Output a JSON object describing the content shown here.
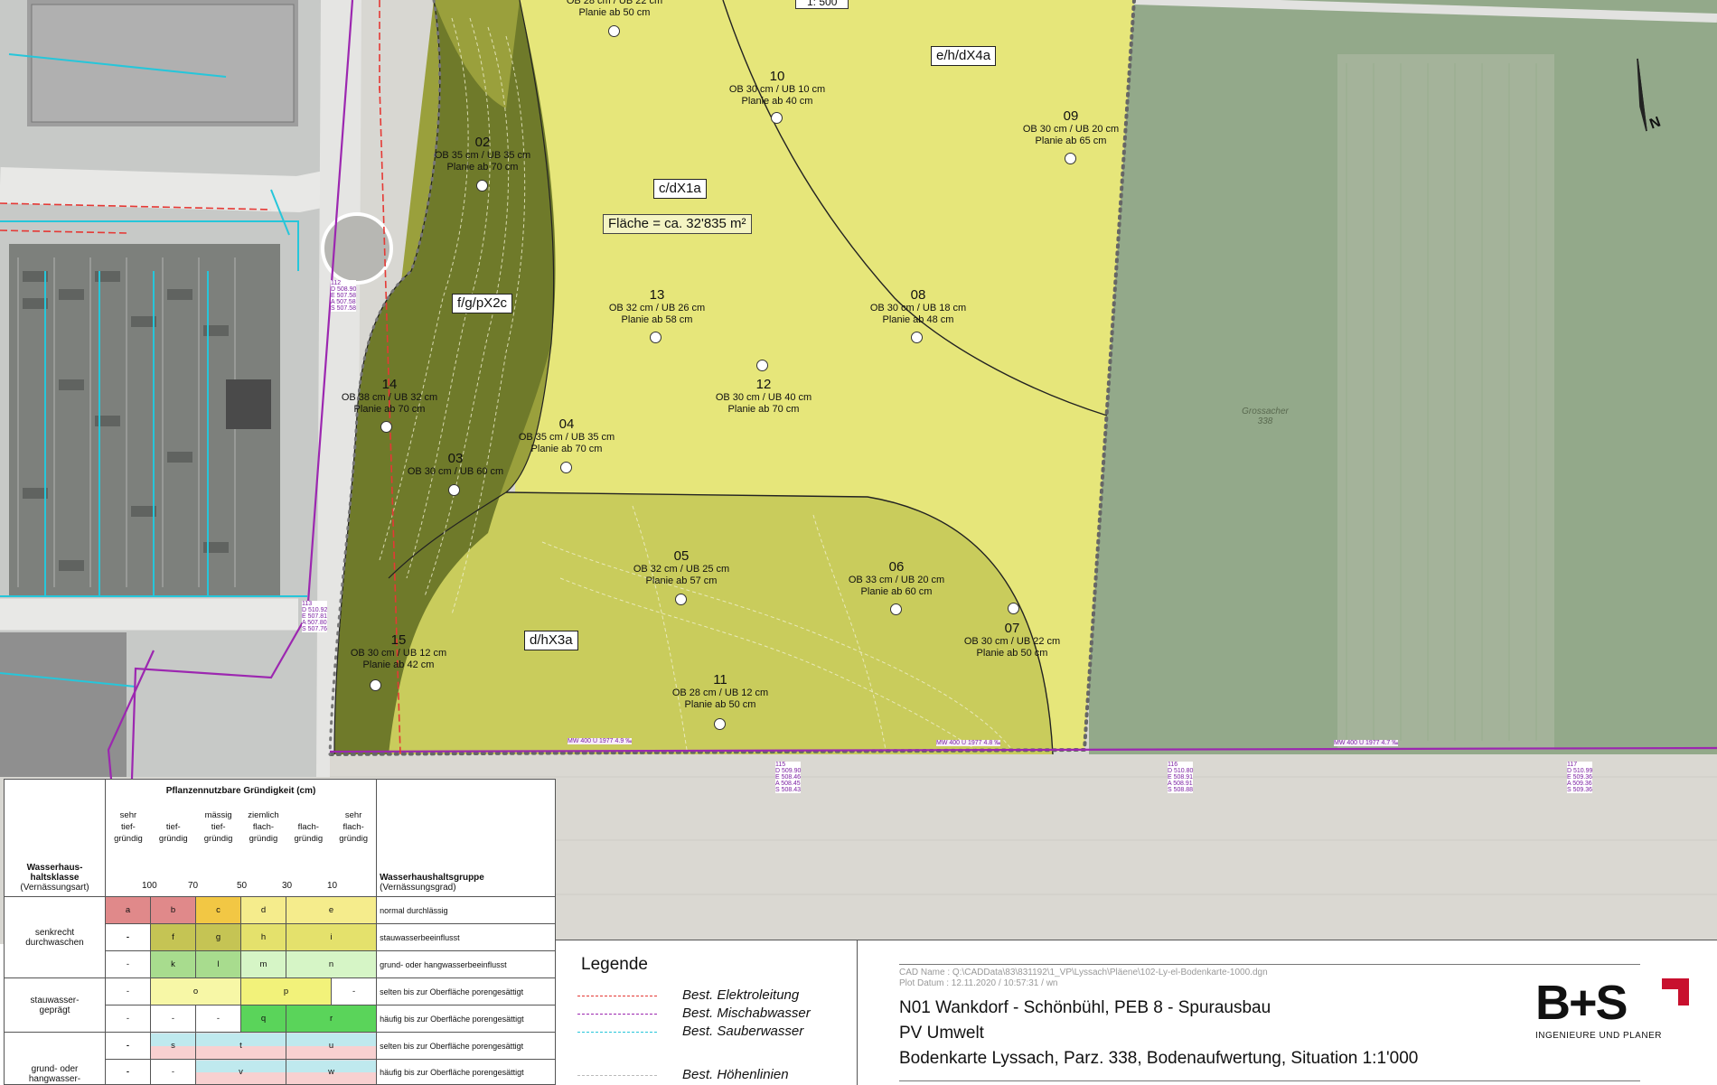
{
  "map": {
    "scale_fragment": "1: 500",
    "soil_units": [
      "e/h/dX4a",
      "c/dX1a",
      "f/g/pX2c",
      "d/hX3a"
    ],
    "area_label": "Fläche = ca. 32'835 m²",
    "field_name": "Grossacher",
    "field_number": "338",
    "north_label": "N",
    "points": [
      {
        "num": "",
        "l1": "OB 28 cm / UB 22 cm",
        "l2": "Planie ab 50 cm"
      },
      {
        "num": "10",
        "l1": "OB 30 cm / UB 10 cm",
        "l2": "Planie ab 40 cm"
      },
      {
        "num": "09",
        "l1": "OB 30 cm / UB 20 cm",
        "l2": "Planie ab 65 cm"
      },
      {
        "num": "02",
        "l1": "OB 35 cm / UB 35 cm",
        "l2": "Planie ab 70 cm"
      },
      {
        "num": "13",
        "l1": "OB 32 cm / UB 26 cm",
        "l2": "Planie ab 58 cm"
      },
      {
        "num": "08",
        "l1": "OB 30 cm / UB 18 cm",
        "l2": "Planie ab 48 cm"
      },
      {
        "num": "12",
        "l1": "OB 30 cm / UB 40 cm",
        "l2": "Planie ab 70 cm"
      },
      {
        "num": "14",
        "l1": "OB 38 cm / UB 32 cm",
        "l2": "Planie ab 70 cm"
      },
      {
        "num": "04",
        "l1": "OB 35 cm / UB 35 cm",
        "l2": "Planie ab 70 cm"
      },
      {
        "num": "03",
        "l1": "OB 30 cm / UB 60 cm",
        "l2": ""
      },
      {
        "num": "05",
        "l1": "OB 32 cm / UB 25 cm",
        "l2": "Planie ab 57 cm"
      },
      {
        "num": "06",
        "l1": "OB 33 cm / UB 20 cm",
        "l2": "Planie ab 60 cm"
      },
      {
        "num": "07",
        "l1": "OB 30 cm / UB 22 cm",
        "l2": "Planie ab 50 cm"
      },
      {
        "num": "15",
        "l1": "OB 30 cm / UB 12 cm",
        "l2": "Planie ab 42 cm"
      },
      {
        "num": "11",
        "l1": "OB 28 cm / UB 12 cm",
        "l2": "Planie ab 50 cm"
      }
    ],
    "pipe_labels": [
      "MW 400 U 1977 4.9 ‰",
      "MW 400 U 1977 4.8 ‰",
      "MW 400 U 1977 4.7 ‰"
    ],
    "manholes": [
      {
        "id": "115",
        "d": "D 509.90",
        "e": "E 508.46",
        "a": "A 508.45",
        "s": "S 508.43"
      },
      {
        "id": "116",
        "d": "D 510.80",
        "e": "E 508.91",
        "a": "A 508.91",
        "s": "S 508.88"
      },
      {
        "id": "117",
        "d": "D 510.99",
        "e": "E 509.36",
        "a": "A 509.36",
        "s": "S 509.36"
      },
      {
        "id": "112",
        "d": "D 508.90",
        "e": "E 507.58",
        "a": "A 507.58",
        "s": "S 507.58"
      },
      {
        "id": "113",
        "d": "D 510.92",
        "e": "E 507.81",
        "a": "A 507.80",
        "s": "S 507.76"
      }
    ]
  },
  "soil_table": {
    "title": "Pflanzennutzbare Gründigkeit (cm)",
    "left_head_1": "Wasserhaus-",
    "left_head_2": "haltsklasse",
    "left_head_3": "(Vernässungsart)",
    "right_head_1": "Wasserhaushaltsgruppe",
    "right_head_2": "(Vernässungsgrad)",
    "depth_cols": [
      [
        "sehr",
        "tief-",
        "gründig"
      ],
      [
        "tief-",
        "gründig",
        ""
      ],
      [
        "mässig",
        "tief-",
        "gründig"
      ],
      [
        "ziemlich",
        "flach-",
        "gründig"
      ],
      [
        "flach-",
        "gründig",
        ""
      ],
      [
        "sehr",
        "flach-",
        "gründig"
      ]
    ],
    "ticks": [
      "100",
      "70",
      "50",
      "30",
      "10"
    ],
    "classes": [
      "senkrecht durchwaschen",
      "stauwasser- geprägt",
      "grund- oder hangwasser-"
    ],
    "groups": [
      "normal durchlässig",
      "stauwasserbeeinflusst",
      "grund- oder hangwasserbeeinflusst",
      "selten bis zur Oberfläche porengesättigt",
      "häufig bis zur Oberfläche porengesättigt",
      "selten bis zur Oberfläche porengesättigt",
      "häufig bis zur Oberfläche porengesättigt"
    ],
    "codes": {
      "r1": [
        "a",
        "b",
        "c",
        "d",
        "e"
      ],
      "r2": [
        "-",
        "f",
        "g",
        "h",
        "i"
      ],
      "r3": [
        "-",
        "k",
        "l",
        "m",
        "n"
      ],
      "r4": [
        "-",
        "o",
        "p",
        "-"
      ],
      "r5": [
        "-",
        "-",
        "-",
        "q",
        "r"
      ],
      "r6": [
        "-",
        "s",
        "t",
        "u",
        "-"
      ],
      "r7": [
        "-",
        "-",
        "v",
        "w",
        "-"
      ]
    }
  },
  "legend": {
    "title": "Legende",
    "items": [
      {
        "label": "Best. Elektroleitung",
        "color": "#e53935",
        "style": "dashed"
      },
      {
        "label": "Best. Mischabwasser",
        "color": "#9c27b0",
        "style": "dashdot"
      },
      {
        "label": "Best. Sauberwasser",
        "color": "#26c6da",
        "style": "dashdot"
      },
      {
        "label": "Best. Höhenlinien",
        "color": "#bbbbbb",
        "style": "dashed"
      }
    ]
  },
  "titleblock": {
    "cad_name": "CAD Name : Q:\\CADData\\83\\831192\\1_VP\\Lyssach\\Pläene\\102-Ly-el-Bodenkarte-1000.dgn",
    "plot_date": "Plot Datum : 12.11.2020 / 10:57:31 / wn",
    "line1": "N01 Wankdorf - Schönbühl, PEB 8 - Spurausbau",
    "line2": "PV Umwelt",
    "line3": "Bodenkarte Lyssach, Parz. 338, Bodenaufwertung, Situation 1:1'000",
    "logo": "B+S",
    "logo_sub": "INGENIEURE UND PLANER"
  },
  "colors": {
    "zone_light": "#e6e67a",
    "zone_mid": "#c9cc5c",
    "zone_dark": "#9aa03c",
    "zone_darkest": "#6f7a2a",
    "field": "#93a98a",
    "accent_red": "#c8102e"
  }
}
